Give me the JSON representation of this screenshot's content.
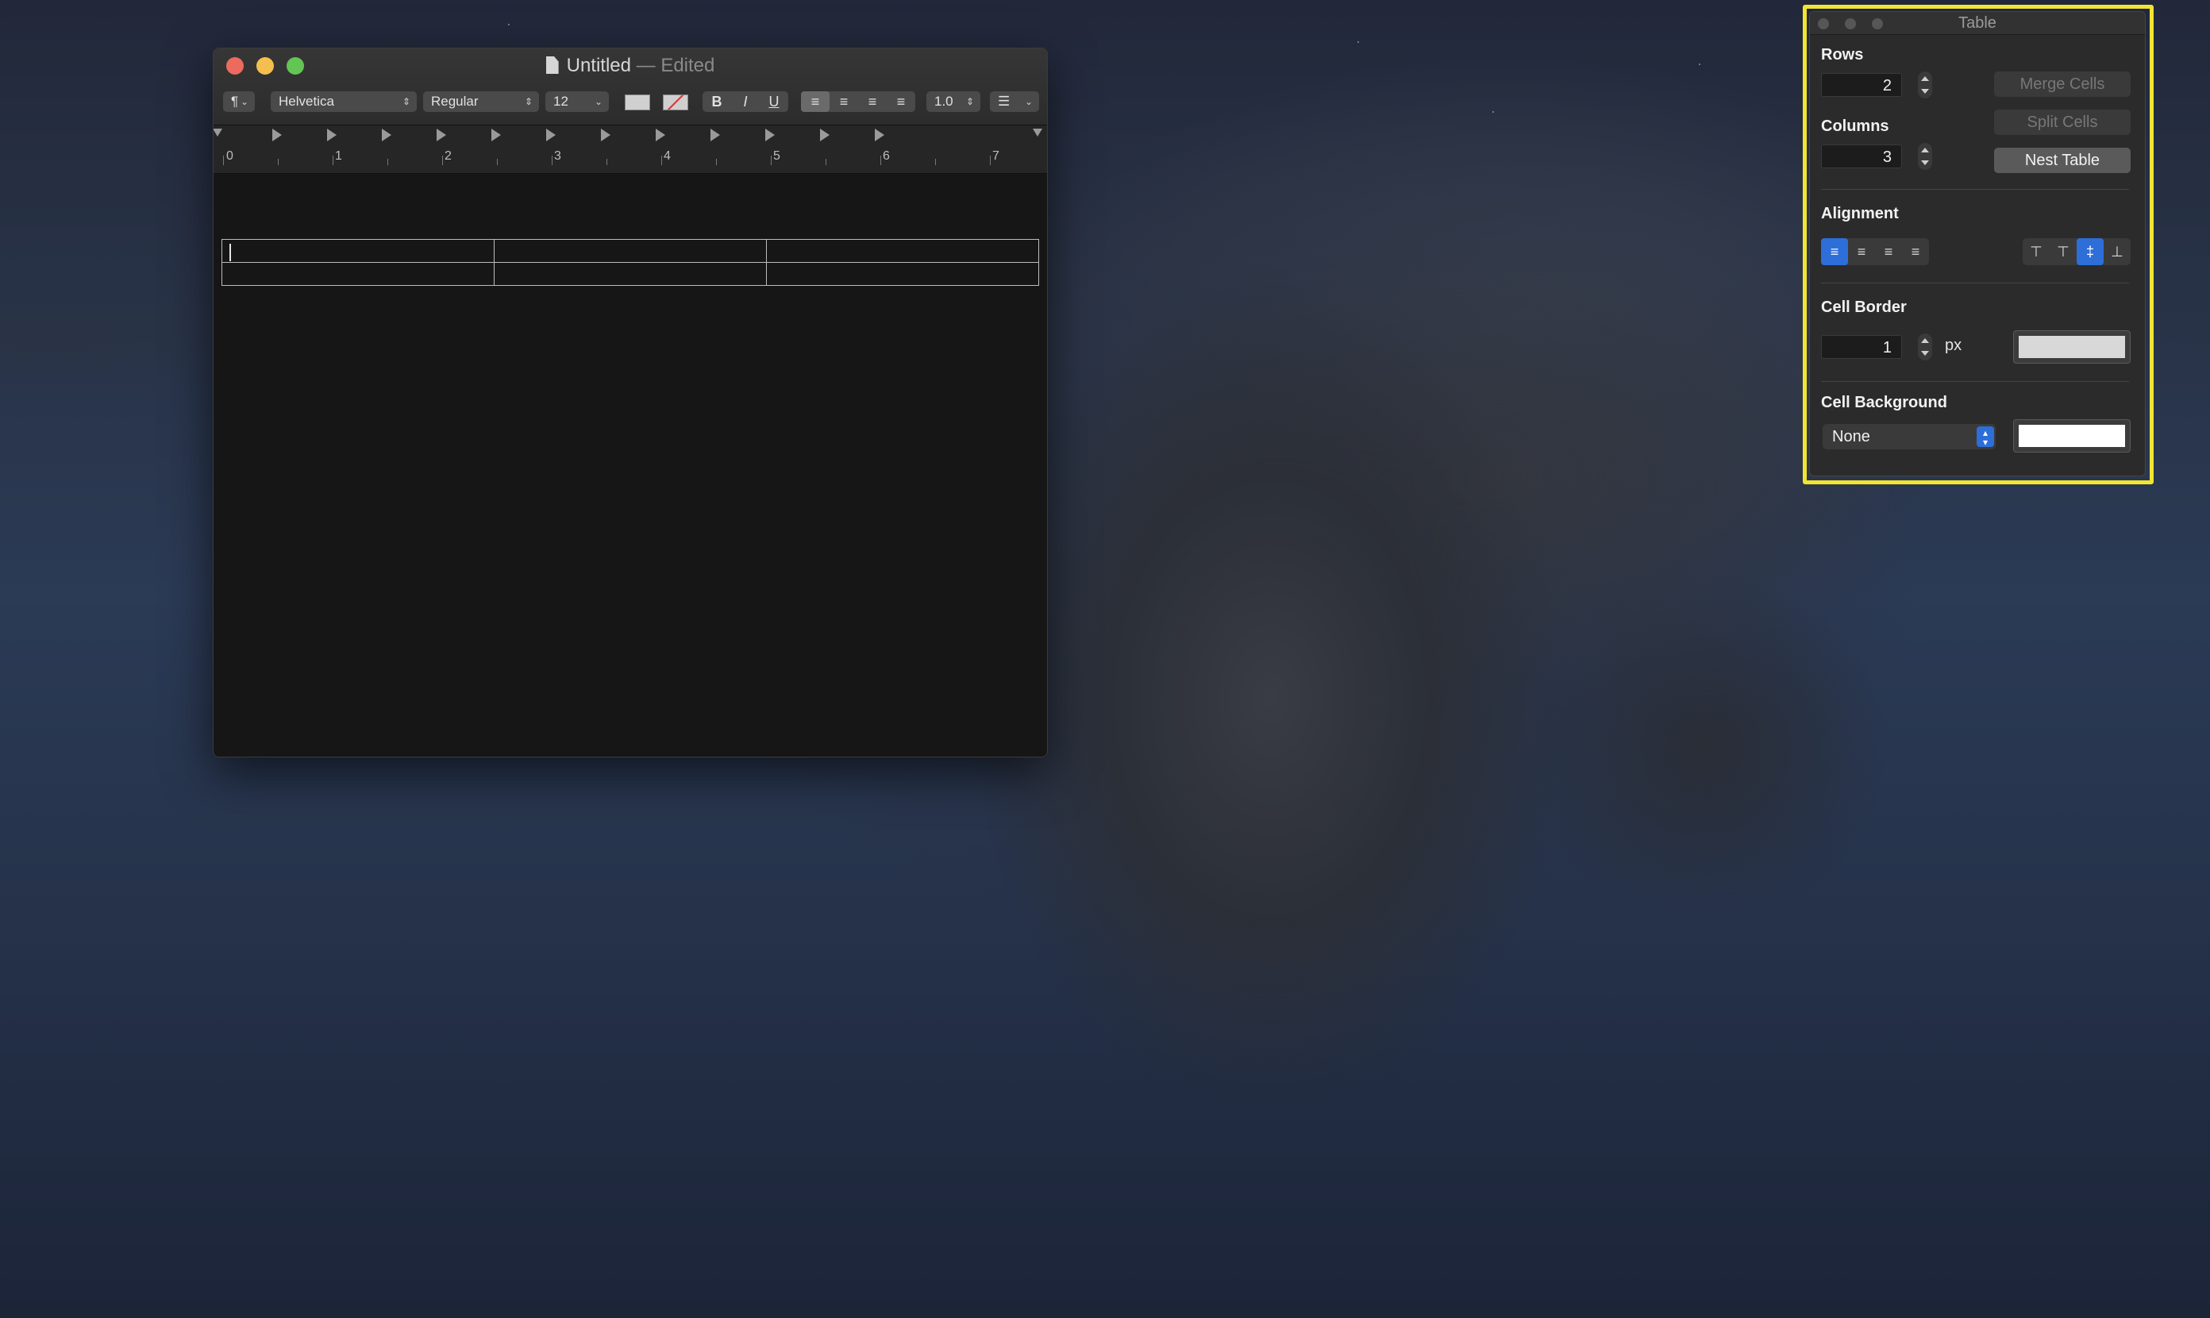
{
  "textedit": {
    "title": "Untitled",
    "title_suffix": "— Edited",
    "toolbar": {
      "paragraph_style": "¶",
      "font_family": "Helvetica",
      "font_style": "Regular",
      "font_size": "12",
      "bold": "B",
      "italic": "I",
      "underline": "U",
      "line_spacing": "1.0",
      "list": "☰"
    },
    "ruler_numbers": [
      "0",
      "1",
      "2",
      "3",
      "4",
      "5",
      "6",
      "7"
    ],
    "table": {
      "rows": 2,
      "columns": 3
    }
  },
  "table_panel": {
    "title": "Table",
    "rows_label": "Rows",
    "rows_value": "2",
    "columns_label": "Columns",
    "columns_value": "3",
    "merge_cells": "Merge Cells",
    "split_cells": "Split Cells",
    "nest_table": "Nest Table",
    "alignment_label": "Alignment",
    "horizontal_alignment": [
      "align-left",
      "align-center",
      "align-justify",
      "align-right"
    ],
    "horizontal_selected": "align-left",
    "vertical_alignment": [
      "align-top",
      "align-baseline",
      "align-middle",
      "align-bottom"
    ],
    "vertical_selected": "align-middle",
    "cell_border_label": "Cell Border",
    "cell_border_value": "1",
    "cell_border_unit": "px",
    "cell_border_color": "#d8d8d8",
    "cell_background_label": "Cell Background",
    "cell_background_option": "None",
    "cell_background_color": "#ffffff"
  },
  "highlight_color": "#f1e532"
}
